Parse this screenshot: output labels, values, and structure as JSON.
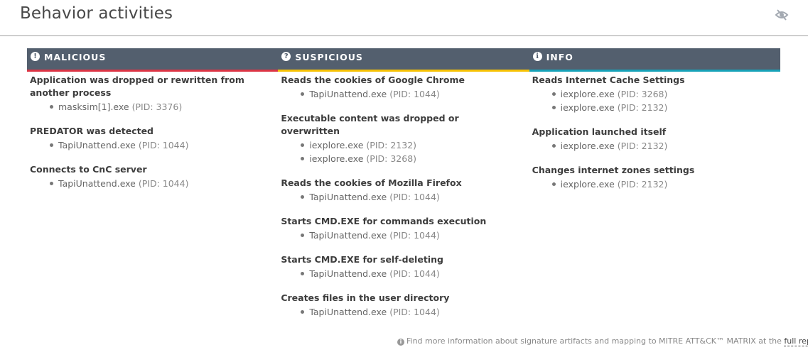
{
  "header": {
    "title": "Behavior activities",
    "hide_icon": "eye-slash-icon"
  },
  "colors": {
    "header_bg": "#535f6e",
    "malicious": "#dc3545",
    "suspicious": "#f7c204",
    "info": "#17a2b8"
  },
  "columns": [
    {
      "label": "MALICIOUS",
      "icon": "exclamation-circle-icon",
      "icon_glyph": "!",
      "groups": [
        {
          "title": "Application was dropped or rewritten from another process",
          "items": [
            {
              "process": "masksim[1].exe",
              "pid": "(PID: 3376)"
            }
          ]
        },
        {
          "title": "PREDATOR was detected",
          "items": [
            {
              "process": "TapiUnattend.exe",
              "pid": "(PID: 1044)"
            }
          ]
        },
        {
          "title": "Connects to CnC server",
          "items": [
            {
              "process": "TapiUnattend.exe",
              "pid": "(PID: 1044)"
            }
          ]
        }
      ]
    },
    {
      "label": "SUSPICIOUS",
      "icon": "question-circle-icon",
      "icon_glyph": "?",
      "groups": [
        {
          "title": "Reads the cookies of Google Chrome",
          "items": [
            {
              "process": "TapiUnattend.exe",
              "pid": "(PID: 1044)"
            }
          ]
        },
        {
          "title": "Executable content was dropped or overwritten",
          "items": [
            {
              "process": "iexplore.exe",
              "pid": "(PID: 2132)"
            },
            {
              "process": "iexplore.exe",
              "pid": "(PID: 3268)"
            }
          ]
        },
        {
          "title": "Reads the cookies of Mozilla Firefox",
          "items": [
            {
              "process": "TapiUnattend.exe",
              "pid": "(PID: 1044)"
            }
          ]
        },
        {
          "title": "Starts CMD.EXE for commands execution",
          "items": [
            {
              "process": "TapiUnattend.exe",
              "pid": "(PID: 1044)"
            }
          ]
        },
        {
          "title": "Starts CMD.EXE for self-deleting",
          "items": [
            {
              "process": "TapiUnattend.exe",
              "pid": "(PID: 1044)"
            }
          ]
        },
        {
          "title": "Creates files in the user directory",
          "items": [
            {
              "process": "TapiUnattend.exe",
              "pid": "(PID: 1044)"
            }
          ]
        }
      ]
    },
    {
      "label": "INFO",
      "icon": "info-circle-icon",
      "icon_glyph": "i",
      "groups": [
        {
          "title": "Reads Internet Cache Settings",
          "items": [
            {
              "process": "iexplore.exe",
              "pid": "(PID: 3268)"
            },
            {
              "process": "iexplore.exe",
              "pid": "(PID: 2132)"
            }
          ]
        },
        {
          "title": "Application launched itself",
          "items": [
            {
              "process": "iexplore.exe",
              "pid": "(PID: 2132)"
            }
          ]
        },
        {
          "title": "Changes internet zones settings",
          "items": [
            {
              "process": "iexplore.exe",
              "pid": "(PID: 2132)"
            }
          ]
        }
      ]
    }
  ],
  "footer": {
    "icon": "info-circle-icon",
    "text": "Find more information about signature artifacts and mapping to MITRE ATT&CK™ MATRIX at the",
    "link_label": "full report",
    "link_icon": "external-link-icon"
  }
}
